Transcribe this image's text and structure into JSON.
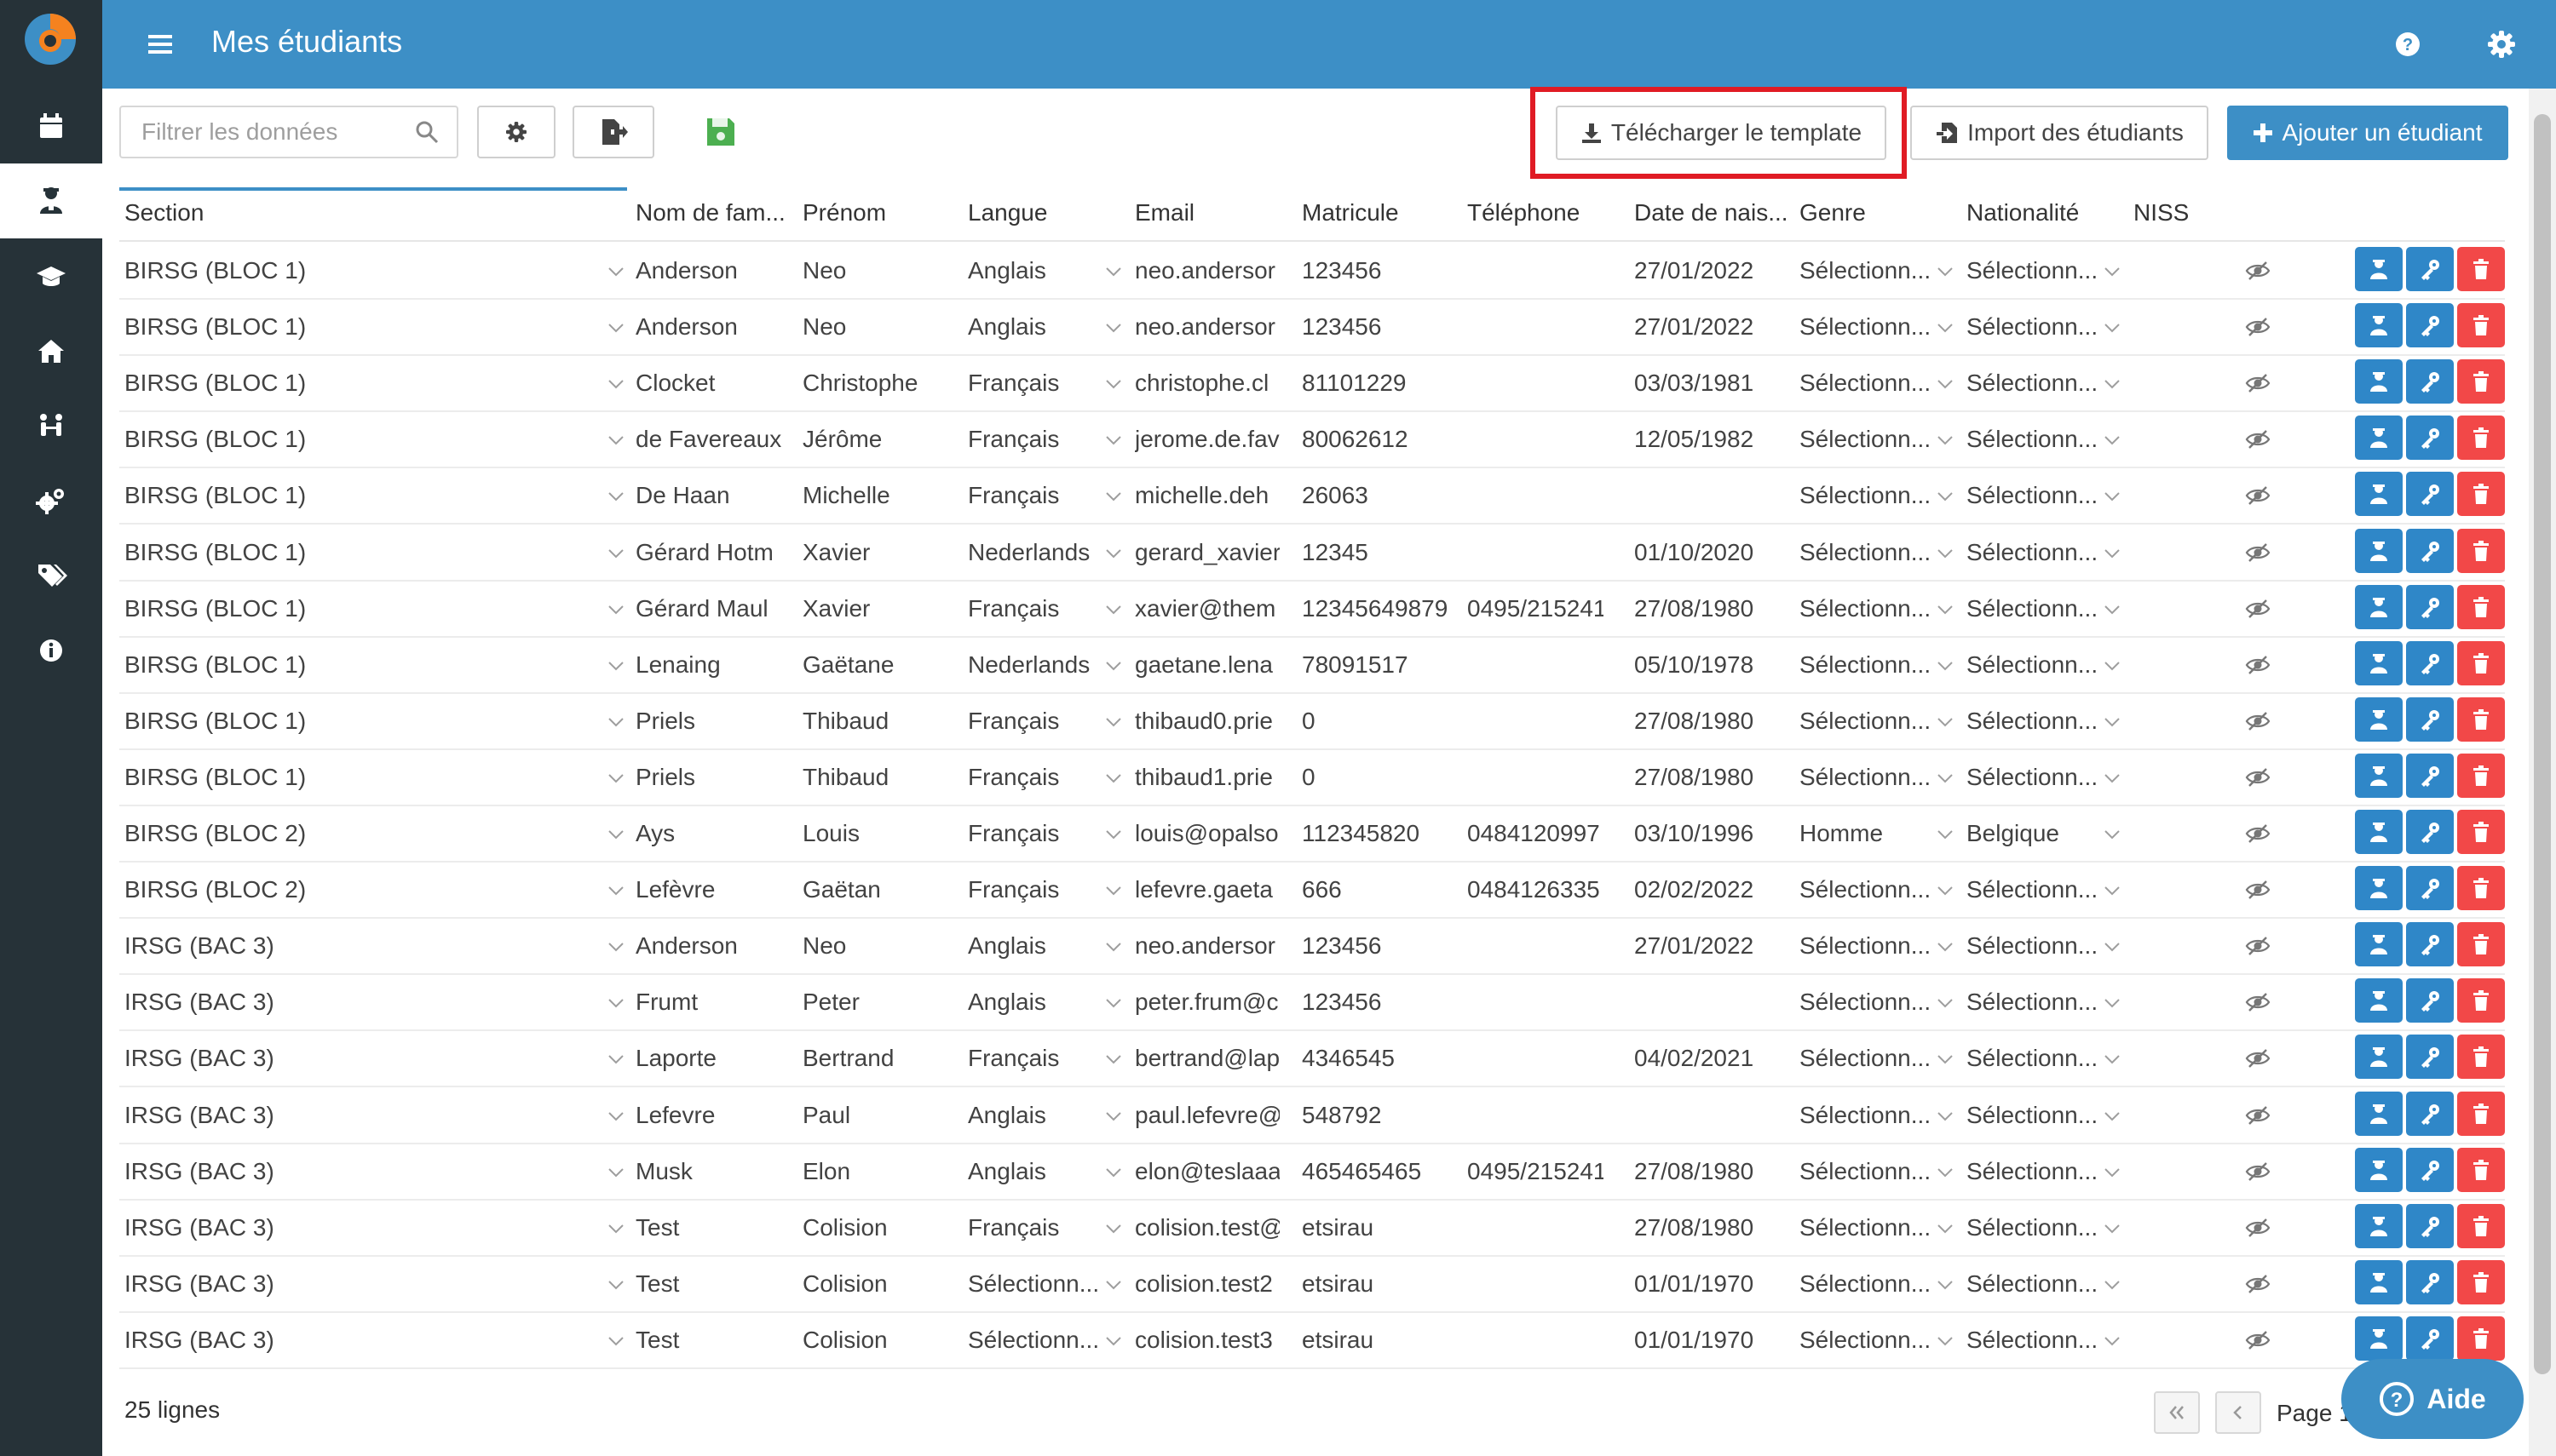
{
  "app": {
    "title": "Mes étudiants"
  },
  "colors": {
    "header": "#3d8fc6",
    "sidebar": "#263238",
    "danger": "#f24848",
    "action": "#2f87c8",
    "highlight": "#e01b24",
    "save": "#4caf50"
  },
  "sidebar": {
    "items": [
      {
        "icon": "calendar-icon"
      },
      {
        "icon": "student-icon",
        "active": true
      },
      {
        "icon": "graduation-cap-icon"
      },
      {
        "icon": "home-icon"
      },
      {
        "icon": "people-icon"
      },
      {
        "icon": "cogs-icon"
      },
      {
        "icon": "tags-icon"
      },
      {
        "icon": "info-icon"
      }
    ]
  },
  "toolbar": {
    "filter_placeholder": "Filtrer les données",
    "download_template_label": "Télécharger le template",
    "import_label": "Import des étudiants",
    "add_label": "Ajouter un étudiant"
  },
  "table": {
    "columns": [
      "Section",
      "Nom de fam...",
      "Prénom",
      "Langue",
      "Email",
      "Matricule",
      "Téléphone",
      "Date de nais...",
      "Genre",
      "Nationalité",
      "NISS"
    ],
    "rows": [
      [
        "BIRSG (BLOC 1)",
        "Anderson",
        "Neo",
        "Anglais",
        "neo.andersor",
        "123456",
        "",
        "27/01/2022",
        "Sélectionn...",
        "Sélectionn..."
      ],
      [
        "BIRSG (BLOC 1)",
        "Anderson",
        "Neo",
        "Anglais",
        "neo.andersor",
        "123456",
        "",
        "27/01/2022",
        "Sélectionn...",
        "Sélectionn..."
      ],
      [
        "BIRSG (BLOC 1)",
        "Clocket",
        "Christophe",
        "Français",
        "christophe.cl",
        "81101229",
        "",
        "03/03/1981",
        "Sélectionn...",
        "Sélectionn..."
      ],
      [
        "BIRSG (BLOC 1)",
        "de Favereaux",
        "Jérôme",
        "Français",
        "jerome.de.fav",
        "80062612",
        "",
        "12/05/1982",
        "Sélectionn...",
        "Sélectionn..."
      ],
      [
        "BIRSG (BLOC 1)",
        "De Haan",
        "Michelle",
        "Français",
        "michelle.deh",
        "26063",
        "",
        "",
        "Sélectionn...",
        "Sélectionn..."
      ],
      [
        "BIRSG (BLOC 1)",
        "Gérard Hotm",
        "Xavier",
        "Nederlands",
        "gerard_xavier",
        "12345",
        "",
        "01/10/2020",
        "Sélectionn...",
        "Sélectionn..."
      ],
      [
        "BIRSG (BLOC 1)",
        "Gérard Maul",
        "Xavier",
        "Français",
        "xavier@them",
        "12345649879",
        "0495/215241",
        "27/08/1980",
        "Sélectionn...",
        "Sélectionn..."
      ],
      [
        "BIRSG (BLOC 1)",
        "Lenaing",
        "Gaëtane",
        "Nederlands",
        "gaetane.lena",
        "78091517",
        "",
        "05/10/1978",
        "Sélectionn...",
        "Sélectionn..."
      ],
      [
        "BIRSG (BLOC 1)",
        "Priels",
        "Thibaud",
        "Français",
        "thibaud0.prie",
        "0",
        "",
        "27/08/1980",
        "Sélectionn...",
        "Sélectionn..."
      ],
      [
        "BIRSG (BLOC 1)",
        "Priels",
        "Thibaud",
        "Français",
        "thibaud1.prie",
        "0",
        "",
        "27/08/1980",
        "Sélectionn...",
        "Sélectionn..."
      ],
      [
        "BIRSG (BLOC 2)",
        "Ays",
        "Louis",
        "Français",
        "louis@opalso",
        "112345820",
        "0484120997",
        "03/10/1996",
        "Homme",
        "Belgique"
      ],
      [
        "BIRSG (BLOC 2)",
        "Lefèvre",
        "Gaëtan",
        "Français",
        "lefevre.gaeta",
        "666",
        "0484126335",
        "02/02/2022",
        "Sélectionn...",
        "Sélectionn..."
      ],
      [
        "IRSG (BAC 3)",
        "Anderson",
        "Neo",
        "Anglais",
        "neo.andersor",
        "123456",
        "",
        "27/01/2022",
        "Sélectionn...",
        "Sélectionn..."
      ],
      [
        "IRSG (BAC 3)",
        "Frumt",
        "Peter",
        "Anglais",
        "peter.frum@c",
        "123456",
        "",
        "",
        "Sélectionn...",
        "Sélectionn..."
      ],
      [
        "IRSG (BAC 3)",
        "Laporte",
        "Bertrand",
        "Français",
        "bertrand@lap",
        "4346545",
        "",
        "04/02/2021",
        "Sélectionn...",
        "Sélectionn..."
      ],
      [
        "IRSG (BAC 3)",
        "Lefevre",
        "Paul",
        "Anglais",
        "paul.lefevre@",
        "548792",
        "",
        "",
        "Sélectionn...",
        "Sélectionn..."
      ],
      [
        "IRSG (BAC 3)",
        "Musk",
        "Elon",
        "Anglais",
        "elon@teslaaa",
        "465465465",
        "0495/215241",
        "27/08/1980",
        "Sélectionn...",
        "Sélectionn..."
      ],
      [
        "IRSG (BAC 3)",
        "Test",
        "Colision",
        "Français",
        "colision.test@",
        "etsirau",
        "",
        "27/08/1980",
        "Sélectionn...",
        "Sélectionn..."
      ],
      [
        "IRSG (BAC 3)",
        "Test",
        "Colision",
        "Sélectionn...",
        "colision.test2",
        "etsirau",
        "",
        "01/01/1970",
        "Sélectionn...",
        "Sélectionn..."
      ],
      [
        "IRSG (BAC 3)",
        "Test",
        "Colision",
        "Sélectionn...",
        "colision.test3",
        "etsirau",
        "",
        "01/01/1970",
        "Sélectionn...",
        "Sélectionn..."
      ]
    ]
  },
  "footer": {
    "row_count": "25 lignes",
    "page_label": "Page 1",
    "help_label": "Aide"
  }
}
